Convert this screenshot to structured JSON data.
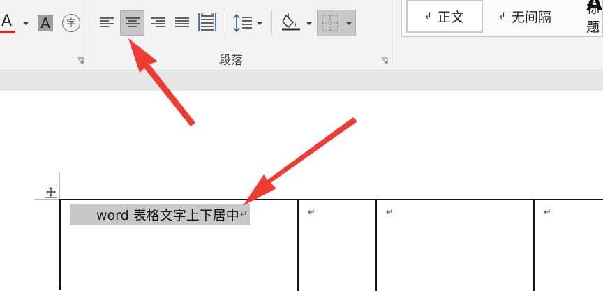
{
  "ribbon": {
    "font_group": {
      "font_color_letter": "A",
      "font_color_bar": "#e02020",
      "char_shading_letter": "A",
      "enclose_char_glyph": "字"
    },
    "paragraph_group": {
      "label": "段落",
      "align_left_icon": "align-left-icon",
      "align_center_icon": "align-center-icon",
      "align_right_icon": "align-right-icon",
      "justify_icon": "justify-icon",
      "distributed_icon": "distributed-icon",
      "line_spacing_icon": "line-spacing-icon",
      "shading_icon": "paint-bucket-icon",
      "borders_icon": "borders-icon",
      "selected_button": "align-center"
    },
    "styles_gallery": {
      "items": [
        {
          "mark": "↲",
          "label": "正文"
        },
        {
          "mark": "↲",
          "label": "无间隔"
        },
        {
          "label": "标题"
        }
      ],
      "heading_glyph": "A"
    }
  },
  "document": {
    "table": {
      "cells": [
        {
          "text": "word 表格文字上下居中",
          "mark": "↵"
        },
        {
          "mark": "↵"
        },
        {
          "mark": "↵"
        },
        {
          "mark": "↵"
        }
      ]
    },
    "move_handle_icon": "move-arrows-icon"
  },
  "colors": {
    "accent_arrow": "#ee3b33",
    "selected_button_bg": "#c6c6c6",
    "text_highlight": "#c8c8c8"
  }
}
